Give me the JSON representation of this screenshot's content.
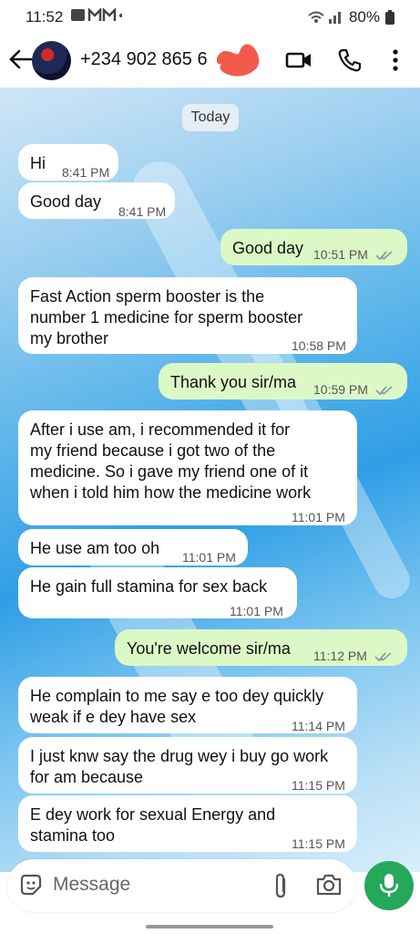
{
  "status_bar": {
    "time": "11:52",
    "battery": "80%"
  },
  "header": {
    "contact": "+234 902 865 6"
  },
  "chat": {
    "date_chip": "Today",
    "messages": [
      {
        "dir": "in",
        "text": "Hi",
        "time": "8:41 PM"
      },
      {
        "dir": "in",
        "text": "Good day",
        "time": "8:41 PM"
      },
      {
        "dir": "out",
        "text": "Good day",
        "time": "10:51 PM"
      },
      {
        "dir": "in",
        "text": "Fast Action sperm booster is the\nnumber 1 medicine for sperm booster\nmy brother",
        "time": "10:58 PM"
      },
      {
        "dir": "out",
        "text": "Thank you sir/ma",
        "time": "10:59 PM"
      },
      {
        "dir": "in",
        "text": "After i use am, i recommended it for\nmy friend because i got two of the\nmedicine. So i gave my friend one of it\nwhen i told him how the medicine work",
        "time": "11:01 PM"
      },
      {
        "dir": "in",
        "text": "He use am too oh",
        "time": "11:01 PM"
      },
      {
        "dir": "in",
        "text": "He gain full stamina for sex back",
        "time": "11:01 PM"
      },
      {
        "dir": "out",
        "text": "You're welcome sir/ma",
        "time": "11:12 PM"
      },
      {
        "dir": "in",
        "text": "He complain to me say e too dey quickly\nweak if e dey have sex",
        "time": "11:14 PM"
      },
      {
        "dir": "in",
        "text": "I just knw say the drug wey i buy go work\nfor am because",
        "time": "11:15 PM"
      },
      {
        "dir": "in",
        "text": "E dey work for sexual Energy and\nstamina too",
        "time": "11:15 PM"
      }
    ]
  },
  "composer": {
    "placeholder": "Message"
  },
  "colors": {
    "outgoing_bubble": "#dcf8c6",
    "mic_button": "#25a85a",
    "read_ticks": "#53bdeb"
  }
}
